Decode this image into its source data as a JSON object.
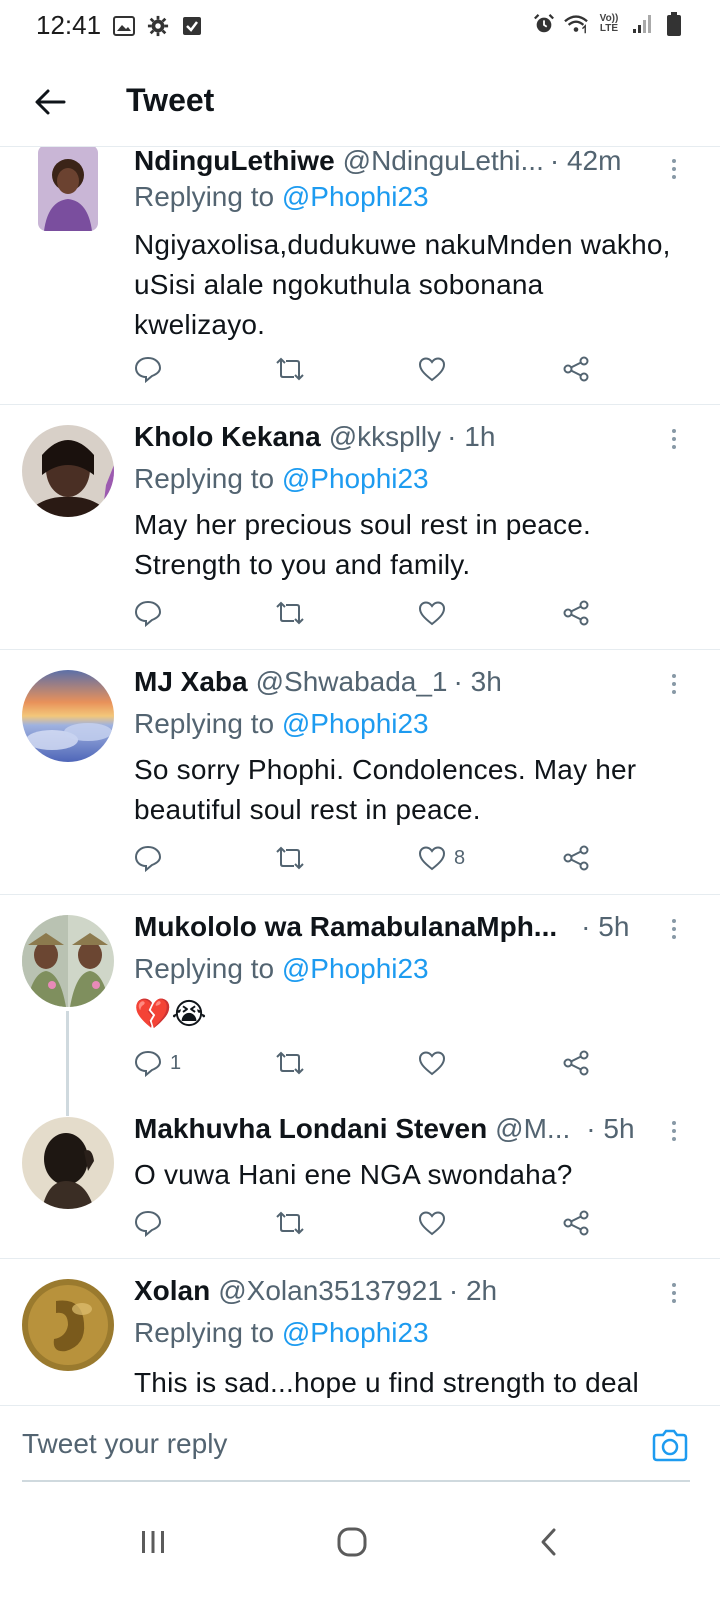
{
  "status_bar": {
    "time": "12:41",
    "left_icons": [
      "image-icon",
      "gear-icon",
      "checkbox-icon"
    ],
    "right_icons": [
      "alarm-icon",
      "wifi-icon",
      "volte-lte-icon",
      "signal-icon",
      "battery-icon"
    ],
    "lte_top": "Vo))",
    "lte_bottom": "LTE"
  },
  "header": {
    "back_icon": "arrow-left-icon",
    "title": "Tweet"
  },
  "colors": {
    "accent": "#1d9bf0",
    "text_primary": "#0f1419",
    "text_secondary": "#536471",
    "divider": "#e6ecf0"
  },
  "tweets": [
    {
      "name": "NdinguLethiwe",
      "handle": "@NdinguLethi...",
      "time": "· 42m",
      "replying_label": "Replying to",
      "replying_to": "@Phophi23",
      "text": "Ngiyaxolisa,dudukuwe nakuMnden wakho, uSisi alale ngokuthula sobonana kwelizayo.",
      "reply_count": "",
      "like_count": ""
    },
    {
      "name": "Kholo Kekana",
      "handle": "@kksplly",
      "time": "· 1h",
      "replying_label": "Replying to",
      "replying_to": "@Phophi23",
      "text": "May her precious soul rest in peace. Strength to you and family.",
      "reply_count": "",
      "like_count": ""
    },
    {
      "name": "MJ Xaba",
      "handle": "@Shwabada_1",
      "time": "· 3h",
      "replying_label": "Replying to",
      "replying_to": "@Phophi23",
      "text": "So sorry Phophi. Condolences. May her beautiful soul rest in peace.",
      "reply_count": "",
      "like_count": "8"
    },
    {
      "name": "Mukololo wa RamabulanaMph...",
      "handle": "",
      "time": "· 5h",
      "replying_label": "Replying to",
      "replying_to": "@Phophi23",
      "text": "💔😭",
      "reply_count": "1",
      "like_count": ""
    },
    {
      "name": "Makhuvha Londani Steven",
      "handle": "@M...",
      "time": "· 5h",
      "text": "O vuwa Hani ene NGA swondaha?",
      "reply_count": "",
      "like_count": ""
    },
    {
      "name": "Xolan",
      "handle": "@Xolan35137921",
      "time": "· 2h",
      "replying_label": "Replying to",
      "replying_to": "@Phophi23",
      "text": "This is sad...hope u find strength to deal",
      "reply_count": "",
      "like_count": ""
    }
  ],
  "reply_bar": {
    "placeholder": "Tweet your reply",
    "camera_icon": "camera-icon"
  },
  "nav_bar": {
    "icons": [
      "recent-apps-icon",
      "home-icon",
      "back-icon"
    ]
  }
}
